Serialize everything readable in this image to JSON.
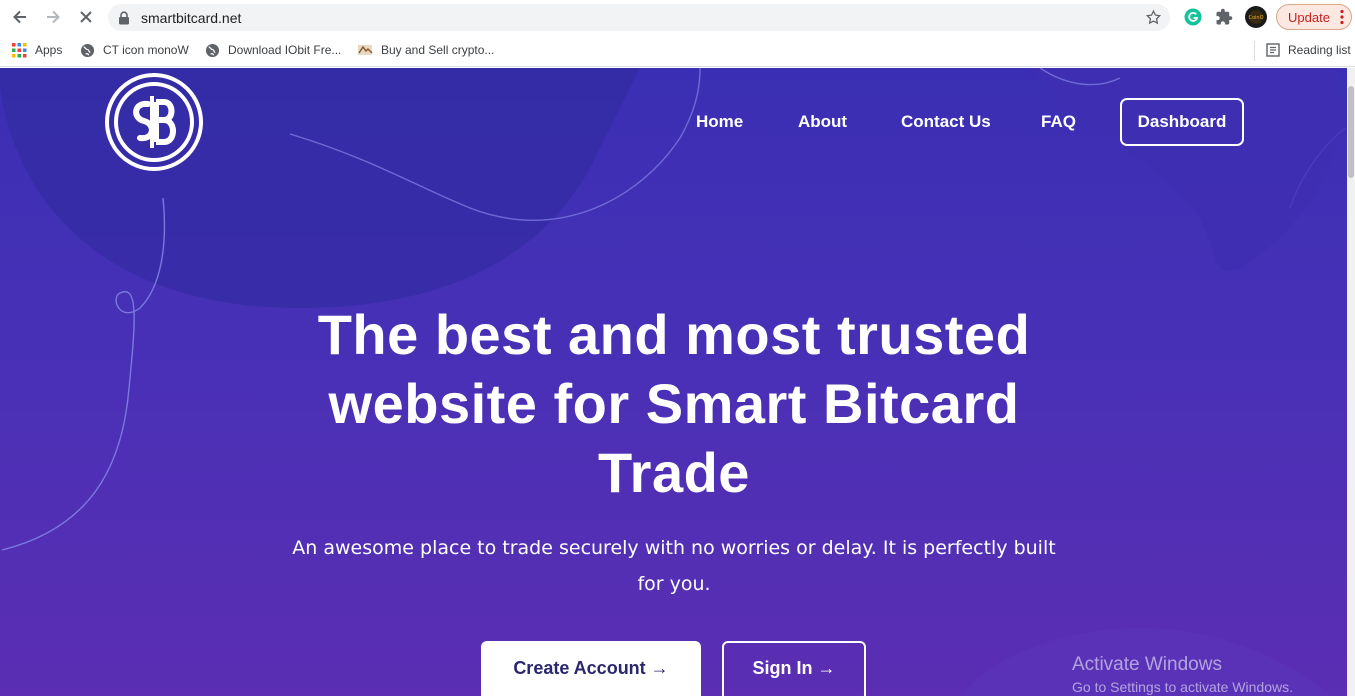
{
  "browser": {
    "url": "smartbitcard.net",
    "update_label": "Update",
    "reading_list_label": "Reading list",
    "bookmarks": [
      {
        "label": "Apps",
        "icon": "apps-grid-icon"
      },
      {
        "label": "CT icon monoW",
        "icon": "globe-icon"
      },
      {
        "label": "Download IObit Fre...",
        "icon": "globe-icon"
      },
      {
        "label": "Buy and Sell crypto...",
        "icon": "site-favicon-icon"
      }
    ]
  },
  "site": {
    "nav": {
      "home": "Home",
      "about": "About",
      "contact": "Contact Us",
      "faq": "FAQ",
      "dashboard": "Dashboard"
    },
    "hero": {
      "title": "The best and most trusted website for Smart Bitcard Trade",
      "subtitle": "An awesome place to trade securely with no worries or delay. It is perfectly built for you.",
      "create_account": "Create Account →",
      "sign_in": "Sign In →"
    }
  },
  "os_watermark": {
    "line1": "Activate Windows",
    "line2": "Go to Settings to activate Windows."
  },
  "colors": {
    "page_top": "#3a2fb4",
    "page_bottom": "#5b2eb3",
    "button_text": "#2a2670"
  }
}
